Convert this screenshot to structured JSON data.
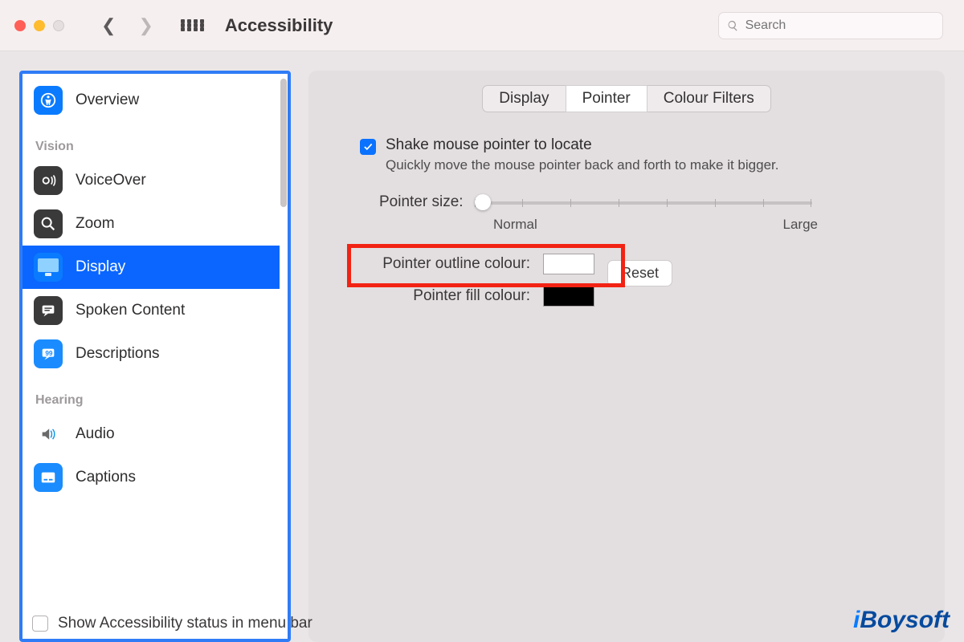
{
  "window": {
    "title": "Accessibility"
  },
  "search": {
    "placeholder": "Search"
  },
  "sidebar": {
    "top_item": {
      "label": "Overview"
    },
    "sections": [
      {
        "title": "Vision",
        "items": [
          {
            "label": "VoiceOver"
          },
          {
            "label": "Zoom"
          },
          {
            "label": "Display",
            "selected": true
          },
          {
            "label": "Spoken Content"
          },
          {
            "label": "Descriptions"
          }
        ]
      },
      {
        "title": "Hearing",
        "items": [
          {
            "label": "Audio"
          },
          {
            "label": "Captions"
          }
        ]
      }
    ]
  },
  "tabs": {
    "items": [
      "Display",
      "Pointer",
      "Colour Filters"
    ],
    "active": "Pointer"
  },
  "pointer": {
    "shake_label": "Shake mouse pointer to locate",
    "shake_desc": "Quickly move the mouse pointer back and forth to make it bigger.",
    "size_label": "Pointer size:",
    "size_min": "Normal",
    "size_max": "Large",
    "outline_label": "Pointer outline colour:",
    "fill_label": "Pointer fill colour:",
    "reset": "Reset",
    "outline_value": "#FFFFFF",
    "fill_value": "#000000"
  },
  "footer": {
    "label": "Show Accessibility status in menu bar"
  },
  "watermark": "iBoysoft",
  "colors": {
    "accent": "#0a66ff",
    "highlight": "#f22314"
  }
}
